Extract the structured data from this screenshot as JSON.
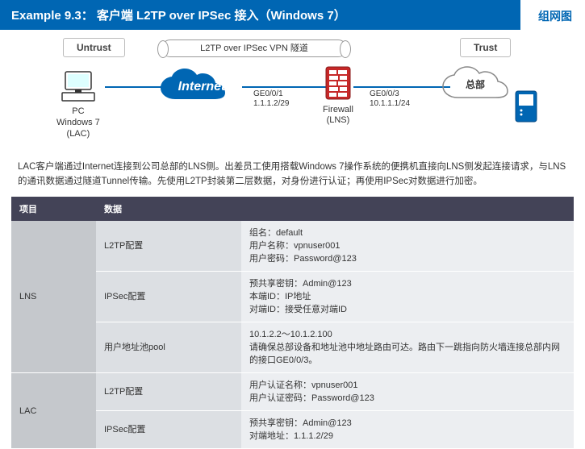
{
  "header": {
    "title": "Example 9.3： 客户端 L2TP over IPSec 接入（Windows 7）",
    "corner": "组网图"
  },
  "diagram": {
    "untrust": "Untrust",
    "trust": "Trust",
    "tunnel": "L2TP over IPSec VPN 隧道",
    "pc": {
      "l1": "PC",
      "l2": "Windows 7",
      "l3": "(LAC)"
    },
    "internet": "Internet",
    "if1": {
      "name": "GE0/0/1",
      "ip": "1.1.1.2/29"
    },
    "firewall": {
      "l1": "Firewall",
      "l2": "(LNS)"
    },
    "if2": {
      "name": "GE0/0/3",
      "ip": "10.1.1.1/24"
    },
    "hq": "总部"
  },
  "desc": "LAC客户端通过Internet连接到公司总部的LNS侧。出差员工使用搭载Windows 7操作系统的便携机直接向LNS侧发起连接请求，与LNS的通讯数据通过隧道Tunnel传输。先使用L2TP封装第二层数据，对身份进行认证；再使用IPSec对数据进行加密。",
  "table": {
    "h1": "项目",
    "h2": "数据",
    "rows": [
      {
        "cat": "LNS",
        "sub": "L2TP配置",
        "val": "组名：default\n用户名称：vpnuser001\n用户密码：Password@123"
      },
      {
        "sub": "IPSec配置",
        "val": "预共享密钥：Admin@123\n本端ID：IP地址\n对端ID：接受任意对端ID"
      },
      {
        "sub": "用户地址池pool",
        "val": "10.1.2.2～10.1.2.100\n请确保总部设备和地址池中地址路由可达。路由下一跳指向防火墙连接总部内网的接口GE0/0/3。"
      },
      {
        "cat": "LAC",
        "sub": "L2TP配置",
        "val": "用户认证名称：vpnuser001\n用户认证密码：Password@123"
      },
      {
        "sub": "IPSec配置",
        "val": "预共享密钥：Admin@123\n对端地址：1.1.1.2/29"
      }
    ]
  }
}
